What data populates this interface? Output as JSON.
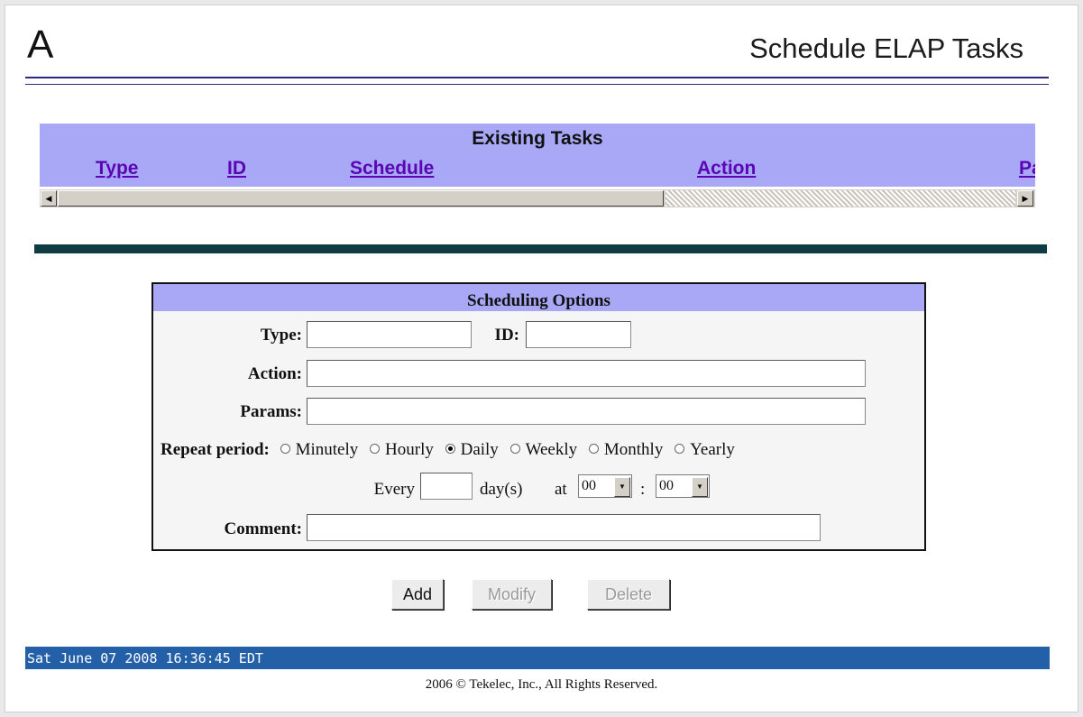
{
  "header": {
    "logo": "A",
    "title": "Schedule ELAP Tasks"
  },
  "existing_tasks": {
    "heading": "Existing Tasks",
    "columns": [
      "Type",
      "ID",
      "Schedule",
      "Action",
      "Pa"
    ]
  },
  "scheduling_options": {
    "heading": "Scheduling Options",
    "type_label": "Type:",
    "type_value": "",
    "id_label": "ID:",
    "id_value": "",
    "action_label": "Action:",
    "action_value": "",
    "params_label": "Params:",
    "params_value": "",
    "repeat_label": "Repeat period:",
    "repeat_options": [
      "Minutely",
      "Hourly",
      "Daily",
      "Weekly",
      "Monthly",
      "Yearly"
    ],
    "repeat_selected": "Daily",
    "every_label": "Every",
    "every_value": "",
    "unit_label": "day(s)",
    "at_label": "at",
    "hour": "00",
    "separator": ":",
    "minute": "00",
    "comment_label": "Comment:",
    "comment_value": ""
  },
  "buttons": {
    "add": "Add",
    "modify": "Modify",
    "delete": "Delete"
  },
  "status_bar": {
    "datetime": "Sat June 07 2008 16:36:45 EDT"
  },
  "footer": {
    "copyright": "2006 © Tekelec, Inc., All Rights Reserved."
  },
  "colors": {
    "header_band": "#a8a8f6",
    "status_bar": "#2460a7",
    "divider": "#0f3b45",
    "link": "#5b05b5"
  }
}
